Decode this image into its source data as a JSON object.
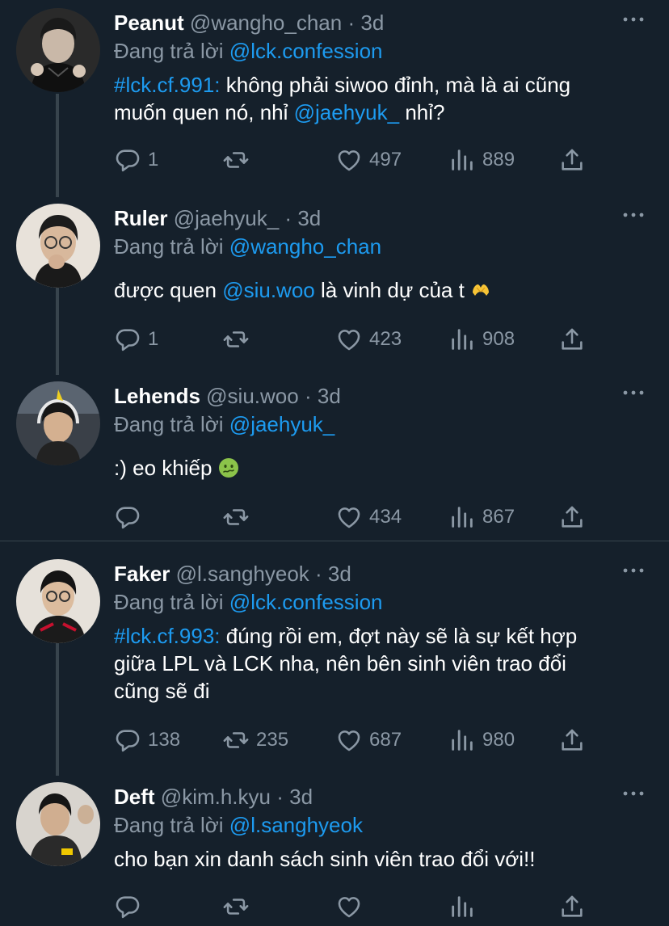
{
  "tweets": [
    {
      "name": "Peanut",
      "handle": "@wangho_chan",
      "time": "3d",
      "reply_prefix": "Đang trả lời",
      "reply_to": "@lck.confession",
      "body_tag": "#lck.cf.991:",
      "body_line1_rest": " không phải siwoo đỉnh, mà là ai cũng",
      "body_line2_text": "muốn quen nó, nhỉ ",
      "body_line2_mention": "@jaehyuk_",
      "body_line2_end": " nhỉ?",
      "replies": "1",
      "retweets": "",
      "likes": "497",
      "views": "889"
    },
    {
      "name": "Ruler",
      "handle": "@jaehyuk_",
      "time": "3d",
      "reply_prefix": "Đang trả lời",
      "reply_to": "@wangho_chan",
      "body_text": "được quen ",
      "body_mention": "@siu.woo",
      "body_end": " là vinh dự của t",
      "emoji": "heart-hands-emoji",
      "replies": "1",
      "retweets": "",
      "likes": "423",
      "views": "908"
    },
    {
      "name": "Lehends",
      "handle": "@siu.woo",
      "time": "3d",
      "reply_prefix": "Đang trả lời",
      "reply_to": "@jaehyuk_",
      "body_text": ":) eo khiếp",
      "emoji": "nauseated-face-emoji",
      "replies": "",
      "retweets": "",
      "likes": "434",
      "views": "867"
    },
    {
      "name": "Faker",
      "handle": "@l.sanghyeok",
      "time": "3d",
      "reply_prefix": "Đang trả lời",
      "reply_to": "@lck.confession",
      "body_tag": "#lck.cf.993:",
      "body_line1_rest": " đúng rồi em, đợt này sẽ là sự kết hợp",
      "body_line2": "giữa LPL và LCK nha, nên bên sinh viên trao đổi",
      "body_line3": "cũng sẽ đi",
      "replies": "138",
      "retweets": "235",
      "likes": "687",
      "views": "980"
    },
    {
      "name": "Deft",
      "handle": "@kim.h.kyu",
      "time": "3d",
      "reply_prefix": "Đang trả lời",
      "reply_to": "@l.sanghyeok",
      "body_text": "cho bạn xin danh sách sinh viên trao đổi với!!",
      "replies": "",
      "retweets": "",
      "likes": "",
      "views": ""
    }
  ],
  "separator": "·",
  "icons": {
    "more": "more-horizontal-icon",
    "reply": "reply-bubble-icon",
    "retweet": "retweet-icon",
    "like": "heart-icon",
    "views": "views-bar-chart-icon",
    "share": "share-upload-icon"
  },
  "colors": {
    "background": "#15202b",
    "text": "#ffffff",
    "secondary": "#8b98a5",
    "link": "#1d9bf0",
    "divider": "#38444d"
  }
}
